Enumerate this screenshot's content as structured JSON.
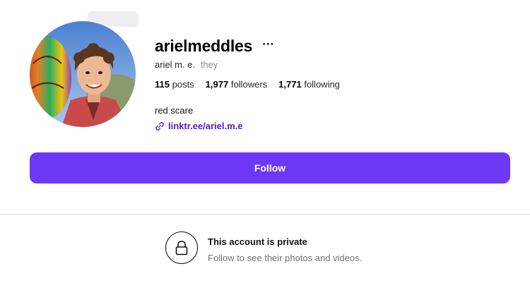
{
  "profile": {
    "username": "arielmeddles",
    "more_label": "···",
    "full_name": "ariel m. e.",
    "pronouns": "they",
    "stats": {
      "posts_count": "115",
      "posts_label": "posts",
      "followers_count": "1,977",
      "followers_label": "followers",
      "following_count": "1,771",
      "following_label": "following"
    },
    "bio": "red scare",
    "link_text": "linktr.ee/ariel.m.e"
  },
  "actions": {
    "follow_label": "Follow"
  },
  "private_notice": {
    "title": "This account is private",
    "subtitle": "Follow to see their photos and videos."
  },
  "icons": {
    "more": "ellipsis-icon",
    "link": "link-icon",
    "lock": "lock-icon"
  },
  "colors": {
    "accent": "#6c38f6",
    "link": "#4e1bd6"
  }
}
